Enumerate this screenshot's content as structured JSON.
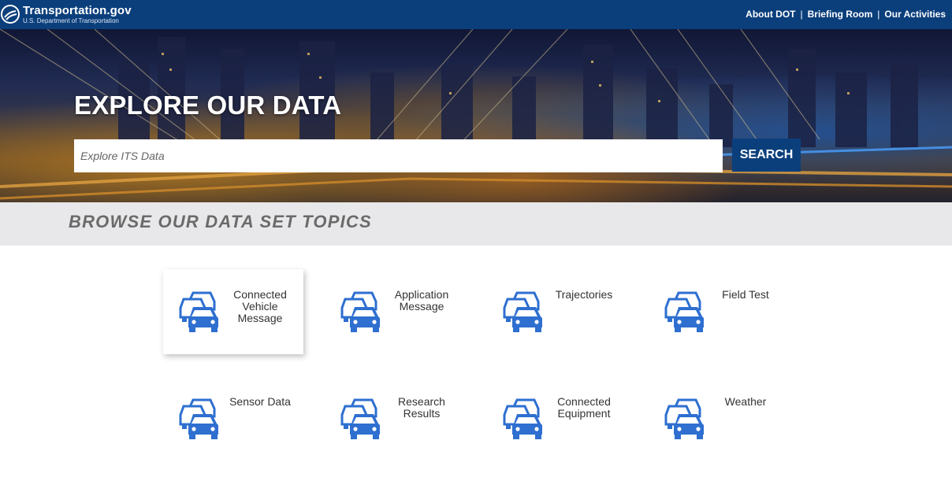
{
  "header": {
    "logo_title": "Transportation.gov",
    "logo_subtitle": "U.S. Department of Transportation",
    "nav": [
      "About DOT",
      "Briefing Room",
      "Our Activities"
    ]
  },
  "hero": {
    "title": "EXPLORE OUR DATA",
    "search_placeholder": "Explore ITS Data",
    "search_value": "",
    "search_button": "SEARCH"
  },
  "browse": {
    "title": "BROWSE OUR DATA SET TOPICS"
  },
  "topics": [
    {
      "label": "Connected Vehicle Message",
      "icon": "cars-icon",
      "active": true
    },
    {
      "label": "Application Message",
      "icon": "cars-icon",
      "active": false
    },
    {
      "label": "Trajectories",
      "icon": "cars-icon",
      "active": false
    },
    {
      "label": "Field Test",
      "icon": "cars-icon",
      "active": false
    },
    {
      "label": "Sensor Data",
      "icon": "cars-icon",
      "active": false
    },
    {
      "label": "Research Results",
      "icon": "cars-icon",
      "active": false
    },
    {
      "label": "Connected Equipment",
      "icon": "cars-icon",
      "active": false
    },
    {
      "label": "Weather",
      "icon": "cars-icon",
      "active": false
    }
  ],
  "colors": {
    "navy": "#0b3f7c",
    "icon_blue": "#2e6fd0",
    "band_gray": "#e8e8ea"
  }
}
